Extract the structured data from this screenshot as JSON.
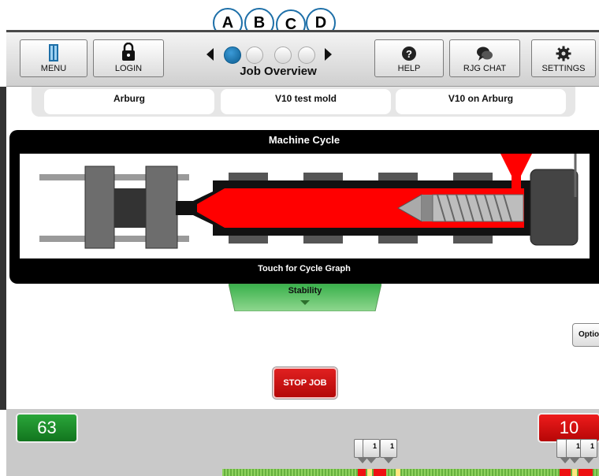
{
  "callouts": [
    "A",
    "B",
    "C",
    "D"
  ],
  "header": {
    "buttons": {
      "menu": "MENU",
      "login": "LOGIN",
      "help": "HELP",
      "chat": "RJG CHAT",
      "settings": "SETTINGS"
    },
    "title": "Job Overview",
    "pager": {
      "pages": 4,
      "active": 1
    }
  },
  "job": {
    "machine": "Arburg",
    "mold": "V10 test mold",
    "name": "V10 on Arburg"
  },
  "machine_cycle": {
    "title": "Machine Cycle",
    "footer": "Touch for Cycle Graph"
  },
  "stability": {
    "label": "Stability"
  },
  "options": {
    "label": "Option"
  },
  "stop_job": {
    "label": "STOP JOB"
  },
  "counts": {
    "good": "63",
    "bad": "10"
  },
  "flags": [
    "1",
    "1",
    "1",
    "1",
    "1",
    "1"
  ],
  "colors": {
    "good": "#1e9b2e",
    "bad": "#e01010",
    "accent": "#1d6fa8",
    "melt": "#ff0000"
  }
}
